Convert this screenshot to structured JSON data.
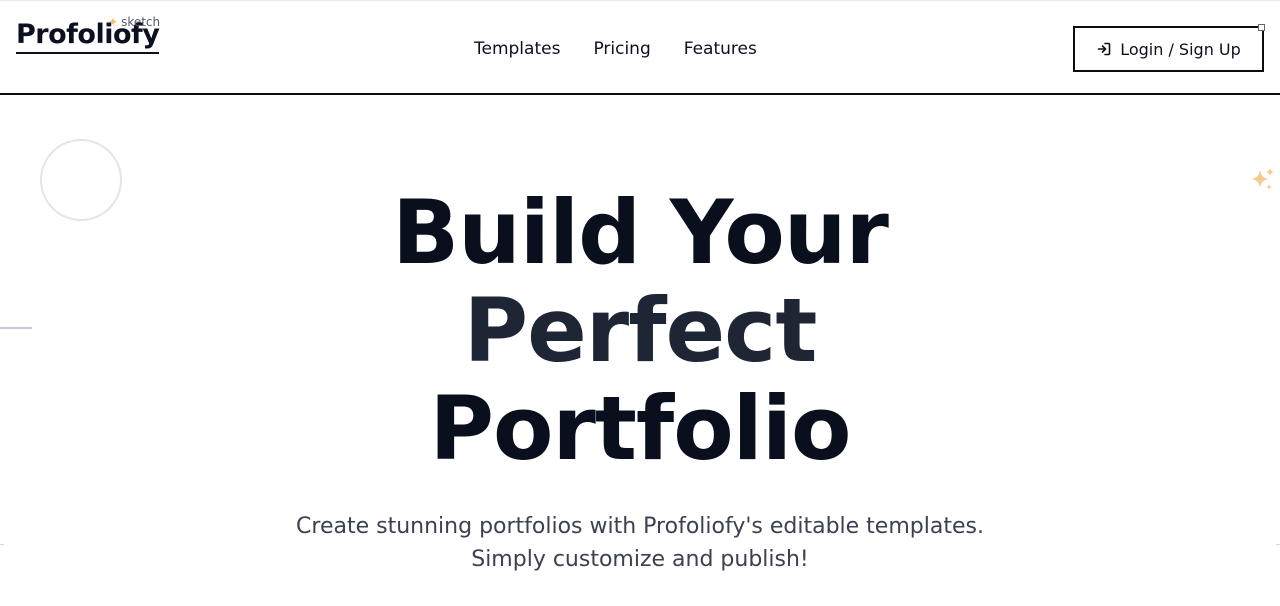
{
  "header": {
    "brand_name": "Profoliofy",
    "brand_tag": "sketch",
    "nav": [
      {
        "label": "Templates"
      },
      {
        "label": "Pricing"
      },
      {
        "label": "Features"
      }
    ],
    "login_label": "Login / Sign Up"
  },
  "hero": {
    "title_line1": "Build Your",
    "title_line2": "Perfect",
    "title_line3": "Portfolio",
    "subtitle_line1": "Create stunning portfolios with Profoliofy's editable templates.",
    "subtitle_line2": "Simply customize and publish!"
  },
  "colors": {
    "text_primary": "#0a0f1e",
    "text_secondary": "#1e2636",
    "subtitle": "#3a4150",
    "accent_sparkle": "#f5c06a",
    "border": "#0b0b12"
  },
  "icons": {
    "brand_sparkle": "sparkle-icon",
    "login": "login-arrow-icon",
    "hero_sparkle": "sparkles-icon"
  }
}
